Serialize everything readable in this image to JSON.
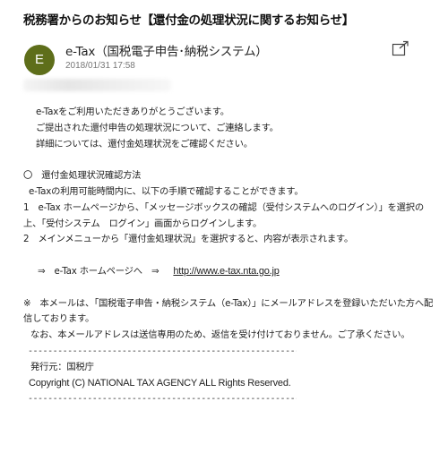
{
  "email": {
    "subject": "税務署からのお知らせ【還付金の処理状況に関するお知らせ】",
    "avatar_letter": "E",
    "sender": "e-Tax（国税電子申告･納税システム）",
    "date": "2018/01/31 17:58"
  },
  "body": {
    "greeting_1": "e-Taxをご利用いただきありがとうございます。",
    "greeting_2": "ご提出された還付申告の処理状況について、ご連絡します。",
    "greeting_3": "詳細については、還付金処理状況をご確認ください。",
    "section_heading": "〇　還付金処理状況確認方法",
    "section_intro": "e-Taxの利用可能時間内に、以下の手順で確認することができます。",
    "step_1": "1　e-Tax ホームページから、「メッセージボックスの確認（受付システムへのログイン）」を選択の上、「受付システム　ログイン」画面からログインします。",
    "step_2": "2　メインメニューから「還付金処理状況」を選択すると、内容が表示されます。",
    "link_prefix": "⇒　e-Tax ホームページへ　⇒",
    "link_url": "http://www.e-tax.nta.go.jp",
    "note_1": "※　本メールは、「国税電子申告・納税システム（e-Tax）」にメールアドレスを登録いただいた方へ配信しております。",
    "note_2": "なお、本メールアドレスは送信専用のため、返信を受け付けておりません。ご了承ください。",
    "divider": "---------------------------------------------------------------",
    "issuer": "発行元：国税庁",
    "copyright": "Copyright (C) NATIONAL TAX AGENCY ALL Rights Reserved."
  },
  "icons": {
    "popout": "open-in-new-window-icon"
  },
  "colors": {
    "avatar_bg": "#5e6e1a",
    "text": "#222222",
    "date": "#777777"
  }
}
